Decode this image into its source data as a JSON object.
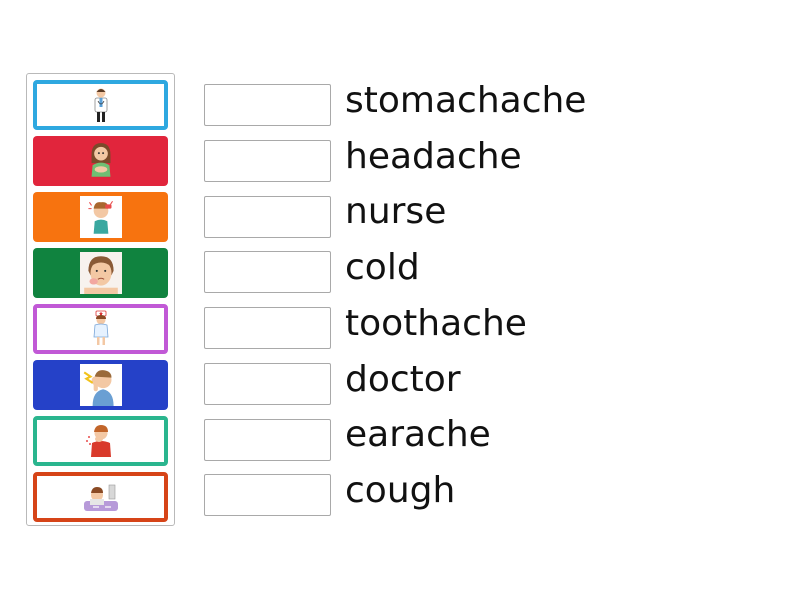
{
  "words": [
    "stomachache",
    "headache",
    "nurse",
    "cold",
    "toothache",
    "doctor",
    "earache",
    "cough"
  ],
  "cards": [
    {
      "style": "outline",
      "color": "#2ea8e0",
      "icon": "doctor-picture-icon"
    },
    {
      "style": "filled",
      "color": "#e1253c",
      "icon": "stomachache-picture-icon"
    },
    {
      "style": "filled",
      "color": "#f7730f",
      "icon": "headache-picture-icon"
    },
    {
      "style": "filled",
      "color": "#10833f",
      "icon": "toothache-picture-icon"
    },
    {
      "style": "outline",
      "color": "#c159d6",
      "icon": "nurse-picture-icon"
    },
    {
      "style": "filled",
      "color": "#2541c8",
      "icon": "earache-picture-icon"
    },
    {
      "style": "outline",
      "color": "#2ab58e",
      "icon": "cough-picture-icon"
    },
    {
      "style": "outline",
      "color": "#d64418",
      "icon": "cold-picture-icon"
    }
  ]
}
